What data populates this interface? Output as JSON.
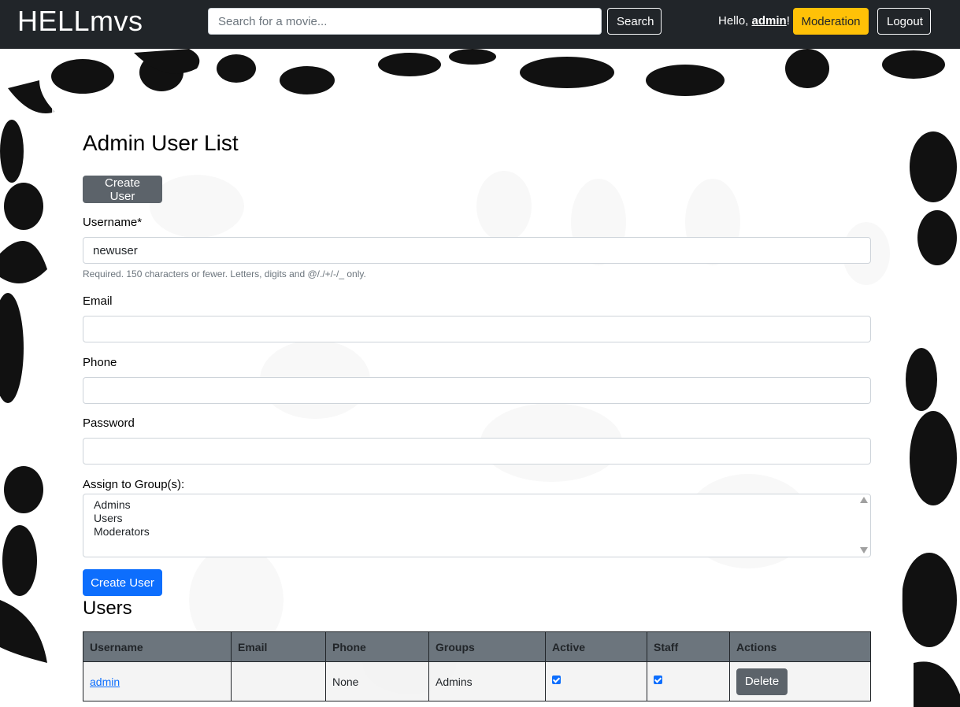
{
  "navbar": {
    "brand": "HELLmvs",
    "search_placeholder": "Search for a movie...",
    "search_label": "Search",
    "greeting_prefix": "Hello, ",
    "username": "admin",
    "greeting_suffix": "!",
    "moderation_label": "Moderation",
    "logout_label": "Logout"
  },
  "page": {
    "title": "Admin User List",
    "toggle_button_label": "Create User"
  },
  "form": {
    "username_label": "Username*",
    "username_value": "newuser",
    "username_help": "Required. 150 characters or fewer. Letters, digits and @/./+/-/_ only.",
    "email_label": "Email",
    "email_value": "",
    "phone_label": "Phone",
    "phone_value": "",
    "password_label": "Password",
    "password_value": "",
    "groups_label": "Assign to Group(s):",
    "groups_options": [
      "Admins",
      "Users",
      "Moderators"
    ],
    "submit_label": "Create User"
  },
  "users": {
    "heading": "Users",
    "columns": [
      "Username",
      "Email",
      "Phone",
      "Groups",
      "Active",
      "Staff",
      "Actions"
    ],
    "rows": [
      {
        "username": "admin",
        "email": "",
        "phone": "None",
        "groups": "Admins",
        "active": true,
        "staff": true,
        "action_label": "Delete"
      }
    ]
  },
  "colors": {
    "navbar_bg": "#212529",
    "primary": "#0d6efd",
    "secondary": "#5c636a",
    "warning": "#ffc107",
    "table_header_bg": "#6c757d"
  }
}
